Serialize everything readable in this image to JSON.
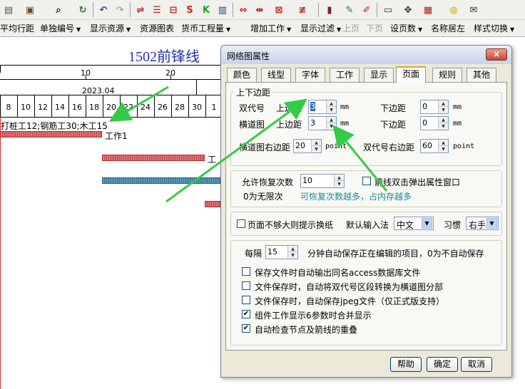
{
  "toolbar2": {
    "items": [
      "平均行距",
      "单独编号",
      "显示资源",
      "资源图表",
      "货币工程量",
      "增加工作",
      "显示过滤",
      "上页",
      "下页",
      "设页数",
      "名称居左",
      "样式切换"
    ]
  },
  "gantt": {
    "title": "1502前锋线",
    "scale_top": [
      "10",
      "20"
    ],
    "month": "2023.04",
    "days": [
      "8",
      "10",
      "12",
      "14",
      "16",
      "18",
      "20",
      "22",
      "24",
      "26",
      "28",
      "30",
      "1"
    ],
    "row1_label": "打桩工12;钢筋工30;木工15",
    "row1_task": "工作1",
    "row2_task_partial": "工"
  },
  "dialog": {
    "title": "网络图属性",
    "close": "×",
    "tabs": [
      "颜色",
      "线型",
      "字体",
      "工作",
      "显示",
      "页面",
      "规则",
      "其他"
    ],
    "active_tab": "页面",
    "margins": {
      "group_title": "上下边距",
      "double_code": "双代号",
      "bar_chart": "横道图",
      "top_margin": "上边距",
      "bottom_margin": "下边距",
      "unit_mm": "mm",
      "double_top": "3",
      "double_bottom": "0",
      "bar_top": "3",
      "bar_bottom": "0",
      "bar_right_label": "横道图右边距",
      "bar_right": "20",
      "double_right_label": "双代号右边距",
      "double_right": "60",
      "unit_point": "point"
    },
    "undo": {
      "label": "允许恢复次数",
      "value": "10",
      "zero_note": "0为无限次",
      "hint": "可恢复次数越多，占内存越多",
      "arrow_popup": "箭线双击弹出属性窗口",
      "hint_color": "#1a8a9a"
    },
    "page": {
      "wrap_hint": "页面不够大则提示换纸",
      "ime_label": "默认输入法",
      "ime_value": "中文",
      "habit_label": "习惯",
      "habit_value": "右手"
    },
    "autosave": {
      "every": "每隔",
      "interval": "15",
      "desc": "分钟自动保存正在编辑的项目，0为不自动保存",
      "options": [
        {
          "label": "保存文件时自动输出同名access数据库文件",
          "checked": false
        },
        {
          "label": "文件保存时，自动将双代号区段转换为横道图分部",
          "checked": false
        },
        {
          "label": "文件保存时，自动保存jpeg文件（仅正式版支持）",
          "checked": false
        },
        {
          "label": "组件工作显示6参数时合并显示",
          "checked": true
        },
        {
          "label": "自动检查节点及箭线的重叠",
          "checked": true
        }
      ]
    },
    "buttons": {
      "help": "帮助",
      "ok": "确定",
      "cancel": "取消"
    }
  },
  "colors": {
    "arrow": "#33cc44",
    "bar_red": "#c94848",
    "bar_teal": "#3a7090",
    "title_blue": "#2233aa"
  }
}
